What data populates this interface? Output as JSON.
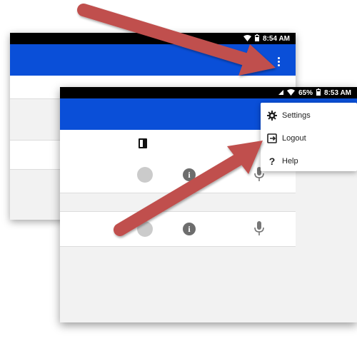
{
  "back_screen": {
    "status_time": "8:54 AM"
  },
  "front_screen": {
    "status_battery": "65%",
    "status_time": "8:53 AM"
  },
  "overflow_menu": {
    "items": [
      {
        "label": "Settings",
        "icon": "gear-icon"
      },
      {
        "label": "Logout",
        "icon": "logout-icon"
      },
      {
        "label": "Help",
        "icon": "help-icon"
      }
    ]
  },
  "colors": {
    "app_bar": "#0a4fd8",
    "arrow": "#c0504d",
    "status_bar": "#000000"
  }
}
